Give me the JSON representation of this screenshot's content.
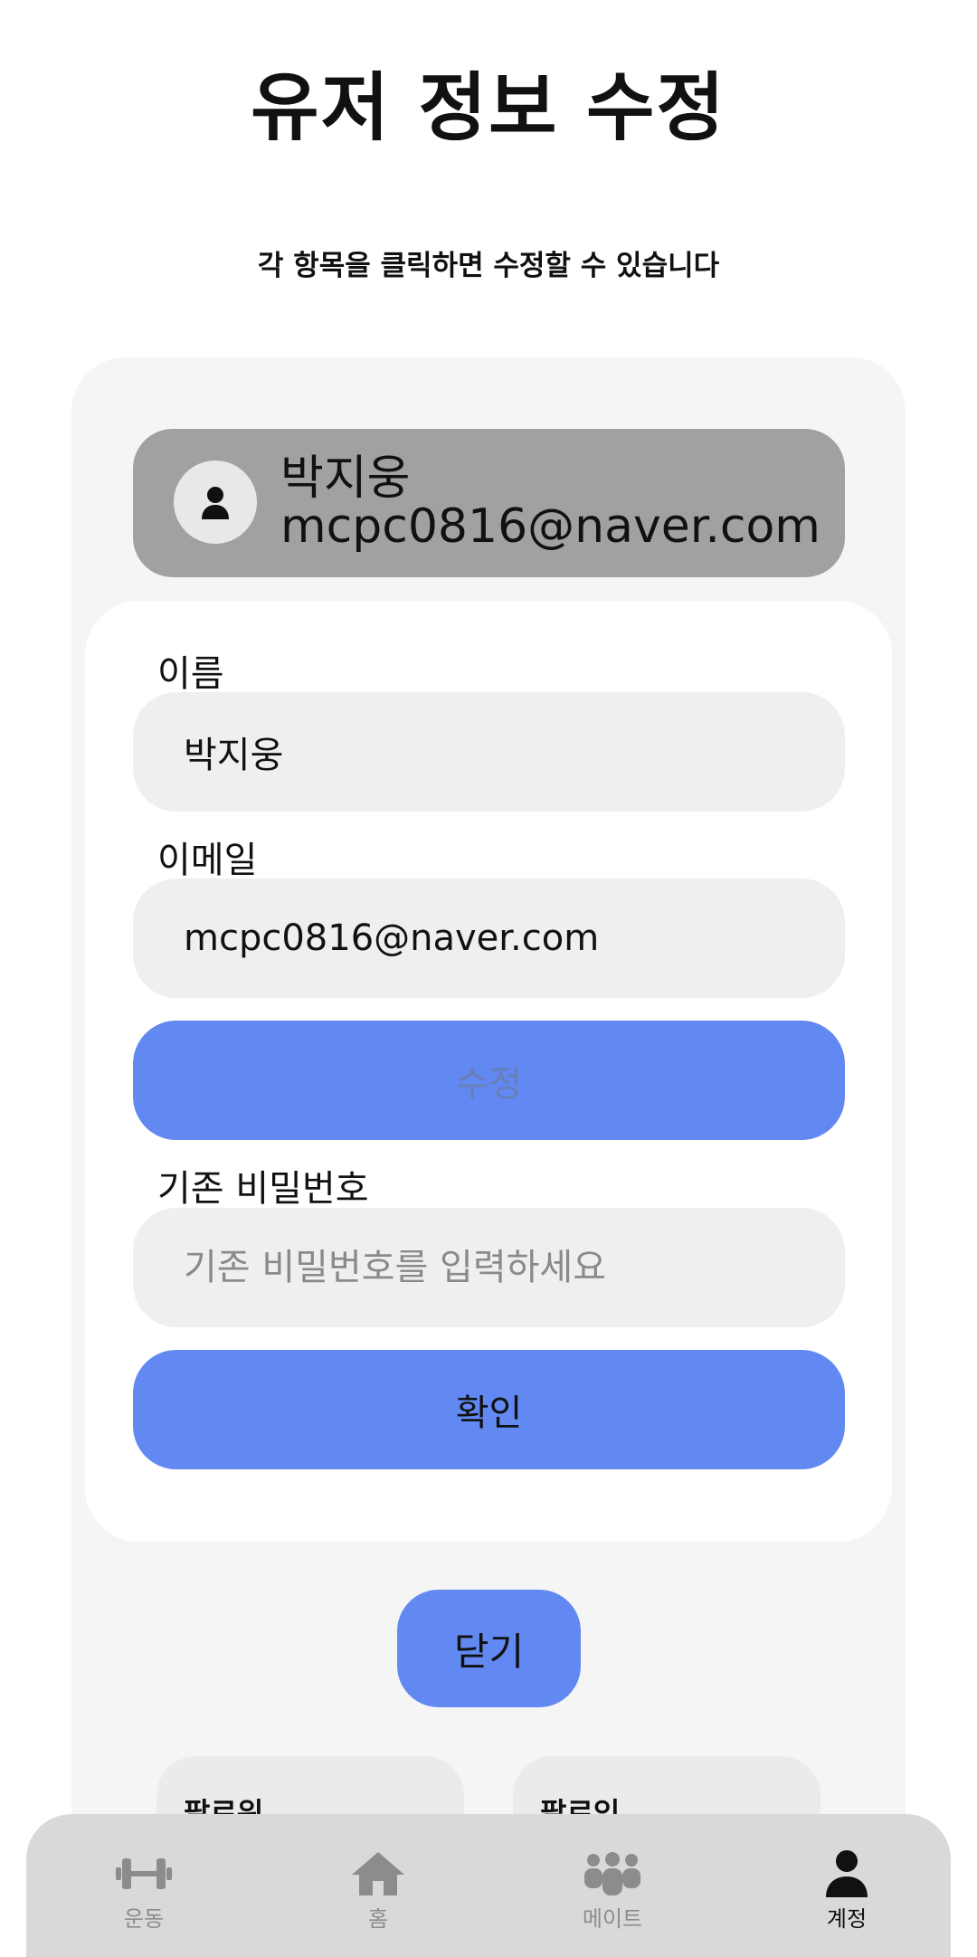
{
  "header": {
    "title": "유저 정보 수정",
    "subtitle": "각 항목을 클릭하면 수정할 수 있습니다"
  },
  "profile": {
    "name": "박지웅",
    "email": "mcpc0816@naver.com",
    "avatar_icon": "person-icon"
  },
  "form": {
    "name_label": "이름",
    "name_value": "박지웅",
    "email_label": "이메일",
    "email_value": "mcpc0816@naver.com",
    "edit_button": "수정",
    "password_label": "기존 비밀번호",
    "password_placeholder": "기존 비밀번호를 입력하세요",
    "confirm_button": "확인"
  },
  "close_button": "닫기",
  "stats": {
    "followers_label": "팔로워",
    "following_label": "팔로잉"
  },
  "bottom_nav": {
    "items": [
      {
        "label": "운동",
        "icon": "dumbbell-icon"
      },
      {
        "label": "홈",
        "icon": "home-icon"
      },
      {
        "label": "메이트",
        "icon": "group-icon"
      },
      {
        "label": "계정",
        "icon": "person-icon",
        "active": true
      }
    ]
  },
  "colors": {
    "accent": "#6289f1",
    "profile_card": "#a1a1a1",
    "panel": "#f5f5f6",
    "field": "#efeff0",
    "nav": "#d9d9d9"
  }
}
